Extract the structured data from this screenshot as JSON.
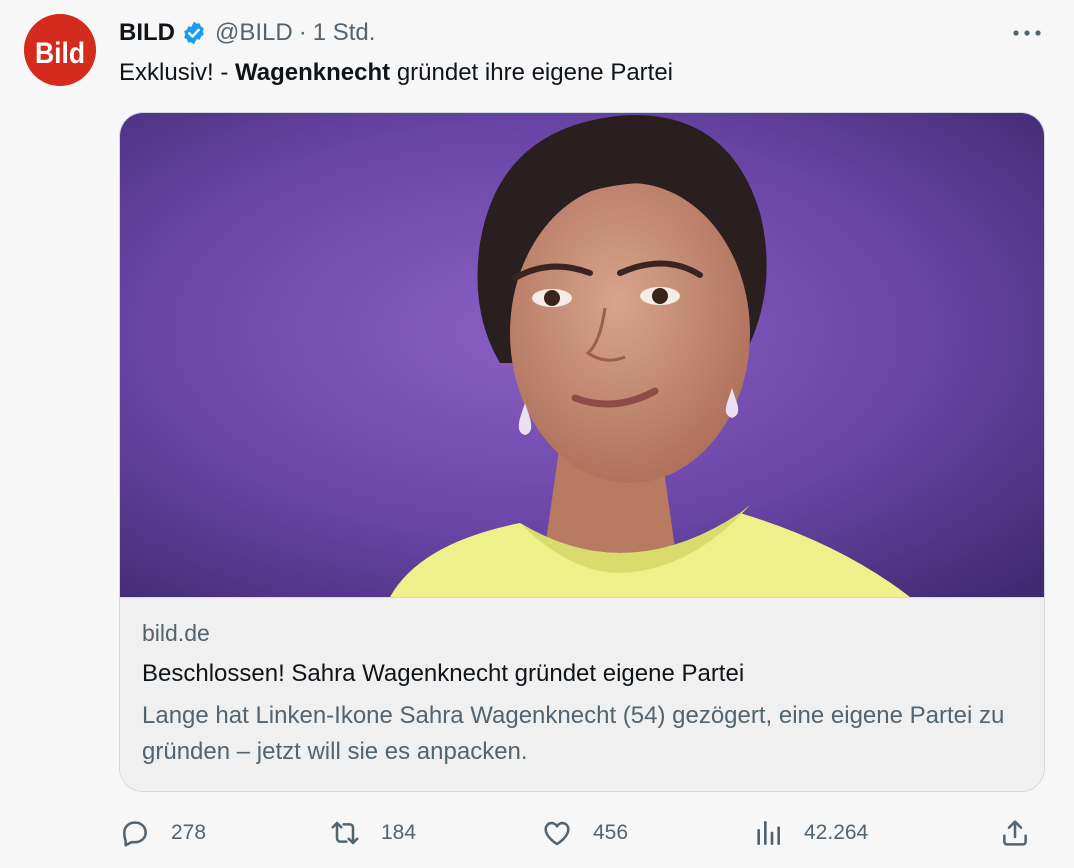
{
  "tweet": {
    "author_name": "BILD",
    "handle": "@BILD",
    "separator": "·",
    "time": "1 Std.",
    "avatar_text": "Bild",
    "text_prefix": "Exklusiv! - ",
    "text_bold": "Wagenknecht",
    "text_suffix": " gründet ihre eigene Partei",
    "more_icon": "more-icon"
  },
  "card": {
    "domain": "bild.de",
    "title": "Beschlossen! Sahra Wagenknecht gründet eigene Partei",
    "description": "Lange hat Linken-Ikone Sahra Wagenknecht (54) gezögert, eine eigene Partei zu gründen – jetzt will sie es anpacken."
  },
  "actions": {
    "replies": "278",
    "retweets": "184",
    "likes": "456",
    "views": "42.264"
  },
  "colors": {
    "brand_red": "#d52b1e",
    "verified_blue": "#1d9bf0",
    "secondary_text": "#536471",
    "photo_background": "#6f4aa8",
    "sweater": "#eef08a"
  }
}
